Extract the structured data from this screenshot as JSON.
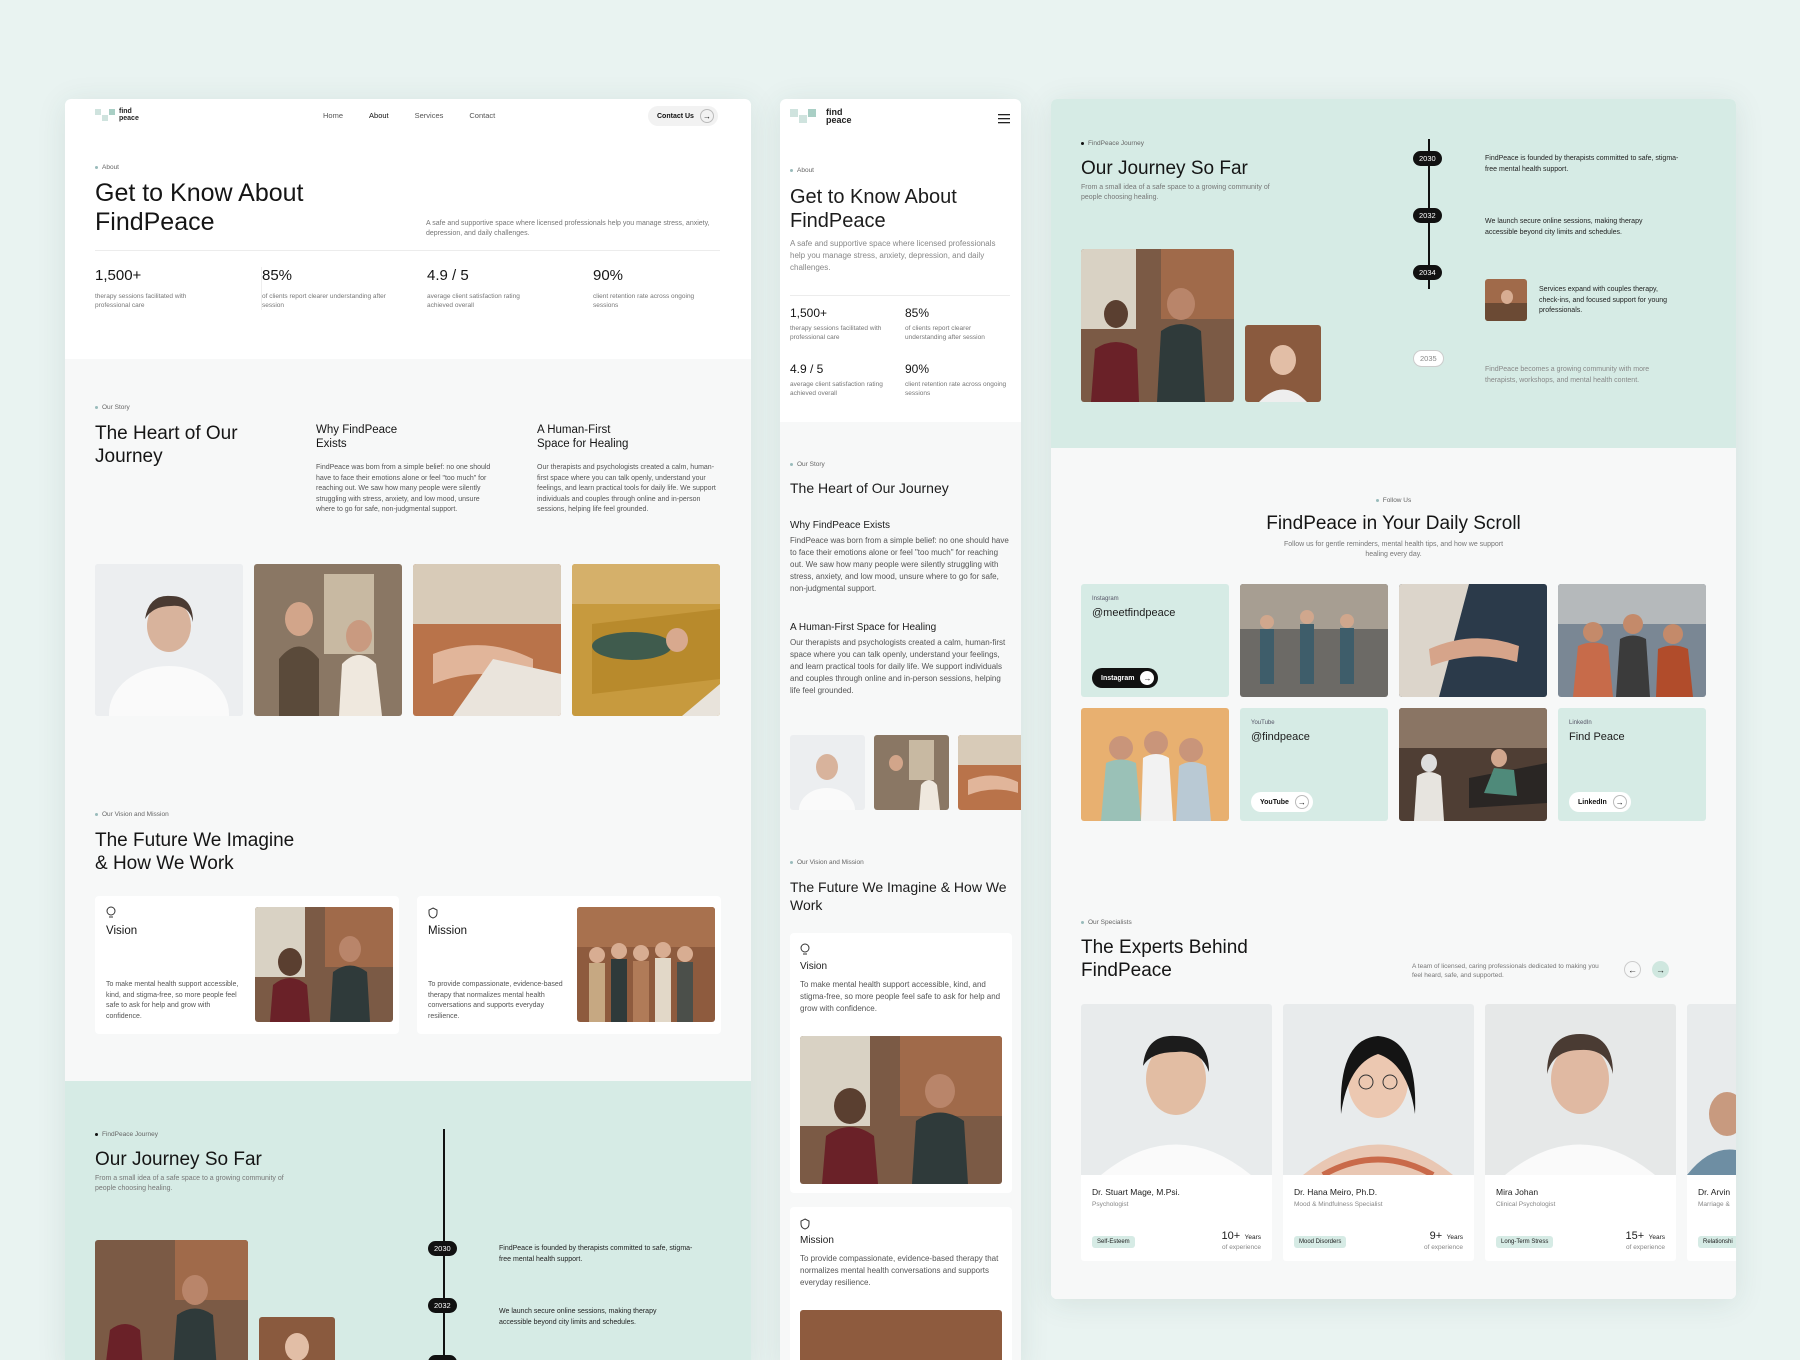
{
  "brand": {
    "line1": "find",
    "line2": "peace"
  },
  "nav": {
    "home": "Home",
    "about": "About",
    "services": "Services",
    "contact": "Contact",
    "cta": "Contact Us"
  },
  "about": {
    "tag": "About",
    "title1": "Get to Know About",
    "title2": "FindPeace",
    "desc": "A safe and supportive space where licensed professionals help you manage stress, anxiety, depression, and daily challenges.",
    "stats": [
      {
        "value": "1,500+",
        "label": "therapy sessions facilitated with professional care"
      },
      {
        "value": "85%",
        "label": "of clients report clearer understanding after session"
      },
      {
        "value": "4.9 / 5",
        "label": "average client satisfaction rating achieved overall"
      },
      {
        "value": "90%",
        "label": "client retention rate across ongoing sessions"
      }
    ]
  },
  "story": {
    "tag": "Our Story",
    "title1": "The Heart of Our",
    "title2": "Journey",
    "title_mobile": "The Heart of Our Journey",
    "why_title1": "Why FindPeace",
    "why_title2": "Exists",
    "why_title_mobile": "Why FindPeace Exists",
    "why_text": "FindPeace was born from a simple belief: no one should have to face their emotions alone or feel \"too much\" for reaching out. We saw how many people were silently struggling with stress, anxiety, and low mood, unsure where to go for safe, non-judgmental support.",
    "human_title1": "A Human-First",
    "human_title2": "Space for Healing",
    "human_title_mobile": "A Human-First Space for Healing",
    "human_text": "Our therapists and psychologists created a calm, human-first space where you can talk openly, understand your feelings, and learn practical tools for daily life. We support individuals and couples through online and in-person sessions, helping life feel grounded."
  },
  "vision": {
    "tag": "Our Vision and Mission",
    "title1": "The Future We Imagine",
    "title2": "& How We Work",
    "title_mobile": "The Future We Imagine & How We Work",
    "vision_label": "Vision",
    "vision_text": "To make mental health support accessible, kind, and stigma-free, so more people feel safe to ask for help and grow with confidence.",
    "mission_label": "Mission",
    "mission_text": "To provide compassionate, evidence-based therapy that normalizes mental health conversations and supports everyday resilience."
  },
  "journey": {
    "tag": "FindPeace Journey",
    "title": "Our Journey So Far",
    "subtitle": "From a small idea of a safe space to a growing community of people choosing healing.",
    "events": [
      {
        "year": "2030",
        "text": "FindPeace is founded by therapists committed to safe, stigma-free mental health support."
      },
      {
        "year": "2032",
        "text": "We launch secure online sessions, making therapy accessible beyond city limits and schedules."
      },
      {
        "year": "2034",
        "text": "Services expand with couples therapy, check-ins, and focused support for young professionals."
      },
      {
        "year": "2035",
        "text": "FindPeace becomes a growing community with more therapists, workshops, and mental health content."
      }
    ]
  },
  "follow": {
    "tag": "Follow Us",
    "title": "FindPeace in Your Daily Scroll",
    "subtitle": "Follow us for gentle reminders, mental health tips, and how we support healing every day.",
    "instagram": {
      "platform": "Instagram",
      "handle": "@meetfindpeace",
      "button": "Instagram"
    },
    "youtube": {
      "platform": "YouTube",
      "handle": "@findpeace",
      "button": "YouTube"
    },
    "linkedin": {
      "platform": "LinkedIn",
      "handle": "Find Peace",
      "button": "LinkedIn"
    }
  },
  "experts": {
    "tag": "Our Specialists",
    "title1": "The Experts Behind",
    "title2": "FindPeace",
    "desc": "A team of licensed, caring professionals dedicated to making you feel heard, safe, and supported.",
    "list": [
      {
        "name": "Dr. Stuart Mage, M.Psi.",
        "role": "Psychologist",
        "tag": "Self-Esteem",
        "years": "10+",
        "years_unit": "Years",
        "exp": "of experience"
      },
      {
        "name": "Dr. Hana Meiro, Ph.D.",
        "role": "Mood & Mindfulness Specialist",
        "tag": "Mood Disorders",
        "years": "9+",
        "years_unit": "Years",
        "exp": "of experience"
      },
      {
        "name": "Mira Johan",
        "role": "Clinical Psychologist",
        "tag": "Long-Term Stress",
        "years": "15+",
        "years_unit": "Years",
        "exp": "of experience"
      },
      {
        "name": "Dr. Arvin",
        "role": "Marriage &",
        "tag": "Relationshi"
      }
    ]
  },
  "icons": {
    "arrow": "arrow-right-icon",
    "menu": "hamburger-menu-icon",
    "bulb": "lightbulb-icon",
    "shield": "shield-icon"
  },
  "colors": {
    "mint": "#d6ebe5",
    "background": "#e9f3f1",
    "dark": "#111111"
  }
}
